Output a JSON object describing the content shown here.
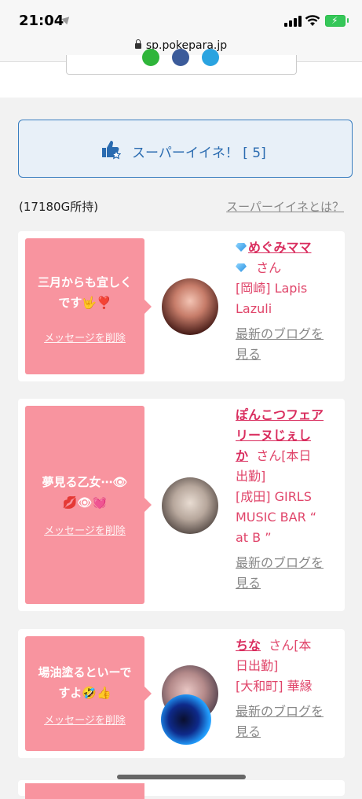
{
  "status": {
    "time": "21:04"
  },
  "browser": {
    "url": "sp.pokepara.jp"
  },
  "super_button": {
    "label": "スーパーイイネ！ [ 5]"
  },
  "points_text": "(17180G所持)",
  "whatis_link": "スーパーイイネとは？",
  "cards": [
    {
      "message_line1": "三月からも宜しく",
      "message_line2": "です🤟❣️",
      "delete_label": "メッセージを削除",
      "name_line1": "めぐみママ",
      "san": "さん",
      "shop": "[岡崎] Lapis",
      "shop2": "Lazuli",
      "blog1": "最新のブログを",
      "blog2": "見る"
    },
    {
      "message_line1": "夢見る乙女⋯👁",
      "message_line2": "💋👁💓",
      "delete_label": "メッセージを削除",
      "name_line1": "ぽんこつフェア",
      "name_line2": "リーヌじぇし",
      "name_line3": "か",
      "san": "さん[本日",
      "san2": "出勤]",
      "shop": "[成田] GIRLS",
      "shop2": "MUSIC BAR “",
      "shop3": "at B ”",
      "blog1": "最新のブログを",
      "blog2": "見る"
    },
    {
      "message_line1": "場油塗るといーで",
      "message_line2": "すよ🤣👍",
      "delete_label": "メッセージを削除",
      "name_line1": "ちな",
      "san": "さん[本",
      "san2": "日出勤]",
      "shop": "[大和町] 華縁",
      "blog1": "最新のブログを",
      "blog2": "見る"
    }
  ],
  "colors": {
    "accent_blue": "#2a6bb0",
    "pink": "#f8949f",
    "name_pink": "#d92d5e"
  }
}
